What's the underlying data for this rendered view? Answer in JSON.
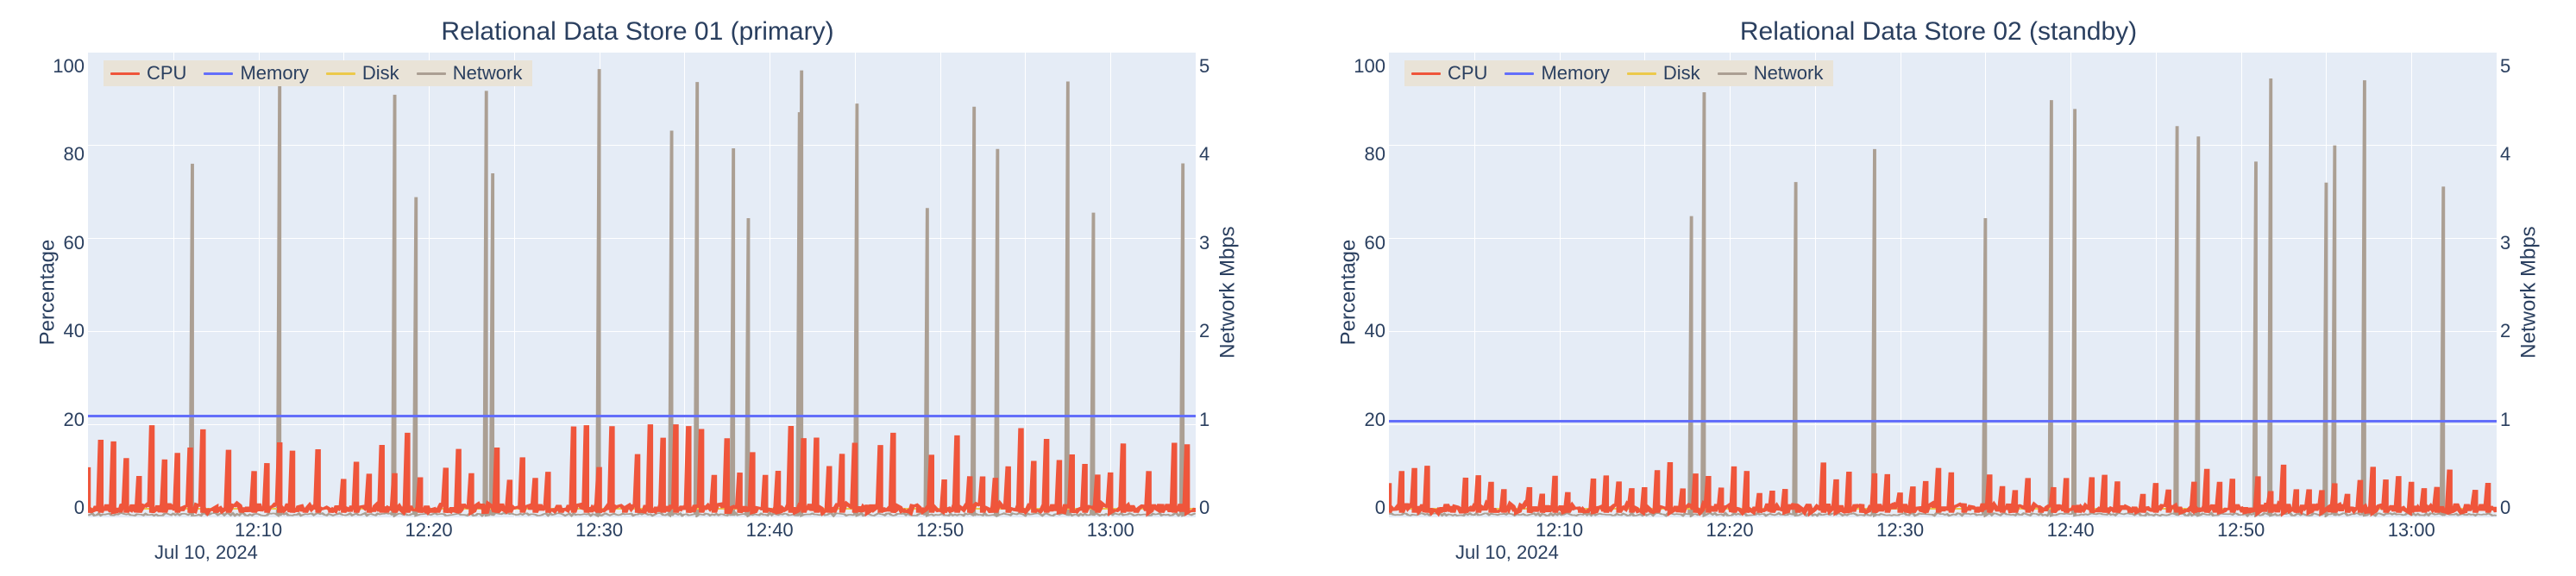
{
  "date_label": "Jul 10, 2024",
  "axes": {
    "left_label": "Percentage",
    "right_label": "Network Mbps",
    "left_ticks": [
      0,
      20,
      40,
      60,
      80,
      100
    ],
    "right_ticks": [
      0,
      1,
      2,
      3,
      4,
      5
    ],
    "x_ticks": [
      "12:10",
      "12:20",
      "12:30",
      "12:40",
      "12:50",
      "13:00"
    ]
  },
  "legend": [
    {
      "name": "CPU",
      "color": "#ef553b"
    },
    {
      "name": "Memory",
      "color": "#636efa"
    },
    {
      "name": "Disk",
      "color": "#ecc94b"
    },
    {
      "name": "Network",
      "color": "#ab9f93"
    }
  ],
  "panels": [
    {
      "id": "ds01",
      "title": "Relational Data Store 01 (primary)",
      "memory_pct": 22,
      "disk_pct": 2
    },
    {
      "id": "ds02",
      "title": "Relational Data Store 02 (standby)",
      "memory_pct": 21,
      "disk_pct": 2
    }
  ],
  "chart_data": [
    {
      "type": "line",
      "title": "Relational Data Store 01 (primary)",
      "xlabel": "",
      "ylabel": "Percentage",
      "y2label": "Network Mbps",
      "ylim": [
        0,
        100
      ],
      "y2lim": [
        0,
        5.5
      ],
      "x_range_minutes": [
        0,
        65
      ],
      "x_tick_labels": [
        "12:10",
        "12:20",
        "12:30",
        "12:40",
        "12:50",
        "13:00"
      ],
      "x_tick_positions_min": [
        10,
        20,
        30,
        40,
        50,
        60
      ],
      "date": "Jul 10, 2024",
      "series": [
        {
          "name": "CPU",
          "axis": "y",
          "color": "#ef553b",
          "approx": "spiky 0–20%, peaks ≈20% roughly every ~0.8–1 min, baseline ≈1–3%"
        },
        {
          "name": "Memory",
          "axis": "y",
          "color": "#636efa",
          "constant_value": 22
        },
        {
          "name": "Disk",
          "axis": "y",
          "color": "#ecc94b",
          "constant_value": 2
        },
        {
          "name": "Network",
          "axis": "y2",
          "color": "#ab9f93",
          "approx": "sparse spikes 0–5 Mbps, ~15–20 tall spikes over the hour, baseline ≈0"
        }
      ]
    },
    {
      "type": "line",
      "title": "Relational Data Store 02 (standby)",
      "xlabel": "",
      "ylabel": "Percentage",
      "y2label": "Network Mbps",
      "ylim": [
        0,
        100
      ],
      "y2lim": [
        0,
        5.5
      ],
      "x_range_minutes": [
        0,
        65
      ],
      "x_tick_labels": [
        "12:10",
        "12:20",
        "12:30",
        "12:40",
        "12:50",
        "13:00"
      ],
      "x_tick_positions_min": [
        10,
        20,
        30,
        40,
        50,
        60
      ],
      "date": "Jul 10, 2024",
      "series": [
        {
          "name": "CPU",
          "axis": "y",
          "color": "#ef553b",
          "approx": "spiky 0–12%, peaks ≈10–12%, baseline ≈1–2%"
        },
        {
          "name": "Memory",
          "axis": "y",
          "color": "#636efa",
          "constant_value": 21
        },
        {
          "name": "Disk",
          "axis": "y",
          "color": "#ecc94b",
          "constant_value": 2
        },
        {
          "name": "Network",
          "axis": "y2",
          "color": "#ab9f93",
          "approx": "sparse spikes 0–5 Mbps, ~12–18 tall spikes over the hour, baseline ≈0"
        }
      ]
    }
  ]
}
